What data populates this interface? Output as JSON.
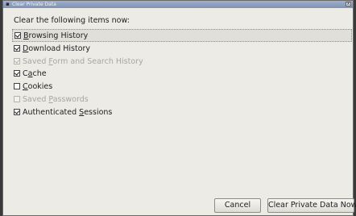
{
  "window": {
    "title": "Clear Private Data",
    "close_glyph": "x"
  },
  "dialog": {
    "heading": "Clear the following items now:",
    "items": [
      {
        "prefix": "",
        "accel": "B",
        "rest": "rowsing History",
        "checked": true,
        "enabled": true
      },
      {
        "prefix": "",
        "accel": "D",
        "rest": "ownload History",
        "checked": true,
        "enabled": true
      },
      {
        "prefix": "Saved ",
        "accel": "F",
        "rest": "orm and Search History",
        "checked": true,
        "enabled": false
      },
      {
        "prefix": "C",
        "accel": "a",
        "rest": "che",
        "checked": true,
        "enabled": true
      },
      {
        "prefix": "",
        "accel": "C",
        "rest": "ookies",
        "checked": false,
        "enabled": true
      },
      {
        "prefix": "Saved ",
        "accel": "P",
        "rest": "asswords",
        "checked": false,
        "enabled": false
      },
      {
        "prefix": "Authenticated ",
        "accel": "S",
        "rest": "essions",
        "checked": true,
        "enabled": true
      }
    ]
  },
  "buttons": {
    "cancel_label": "Cancel",
    "clear_label": "Clear Private Data Now"
  }
}
